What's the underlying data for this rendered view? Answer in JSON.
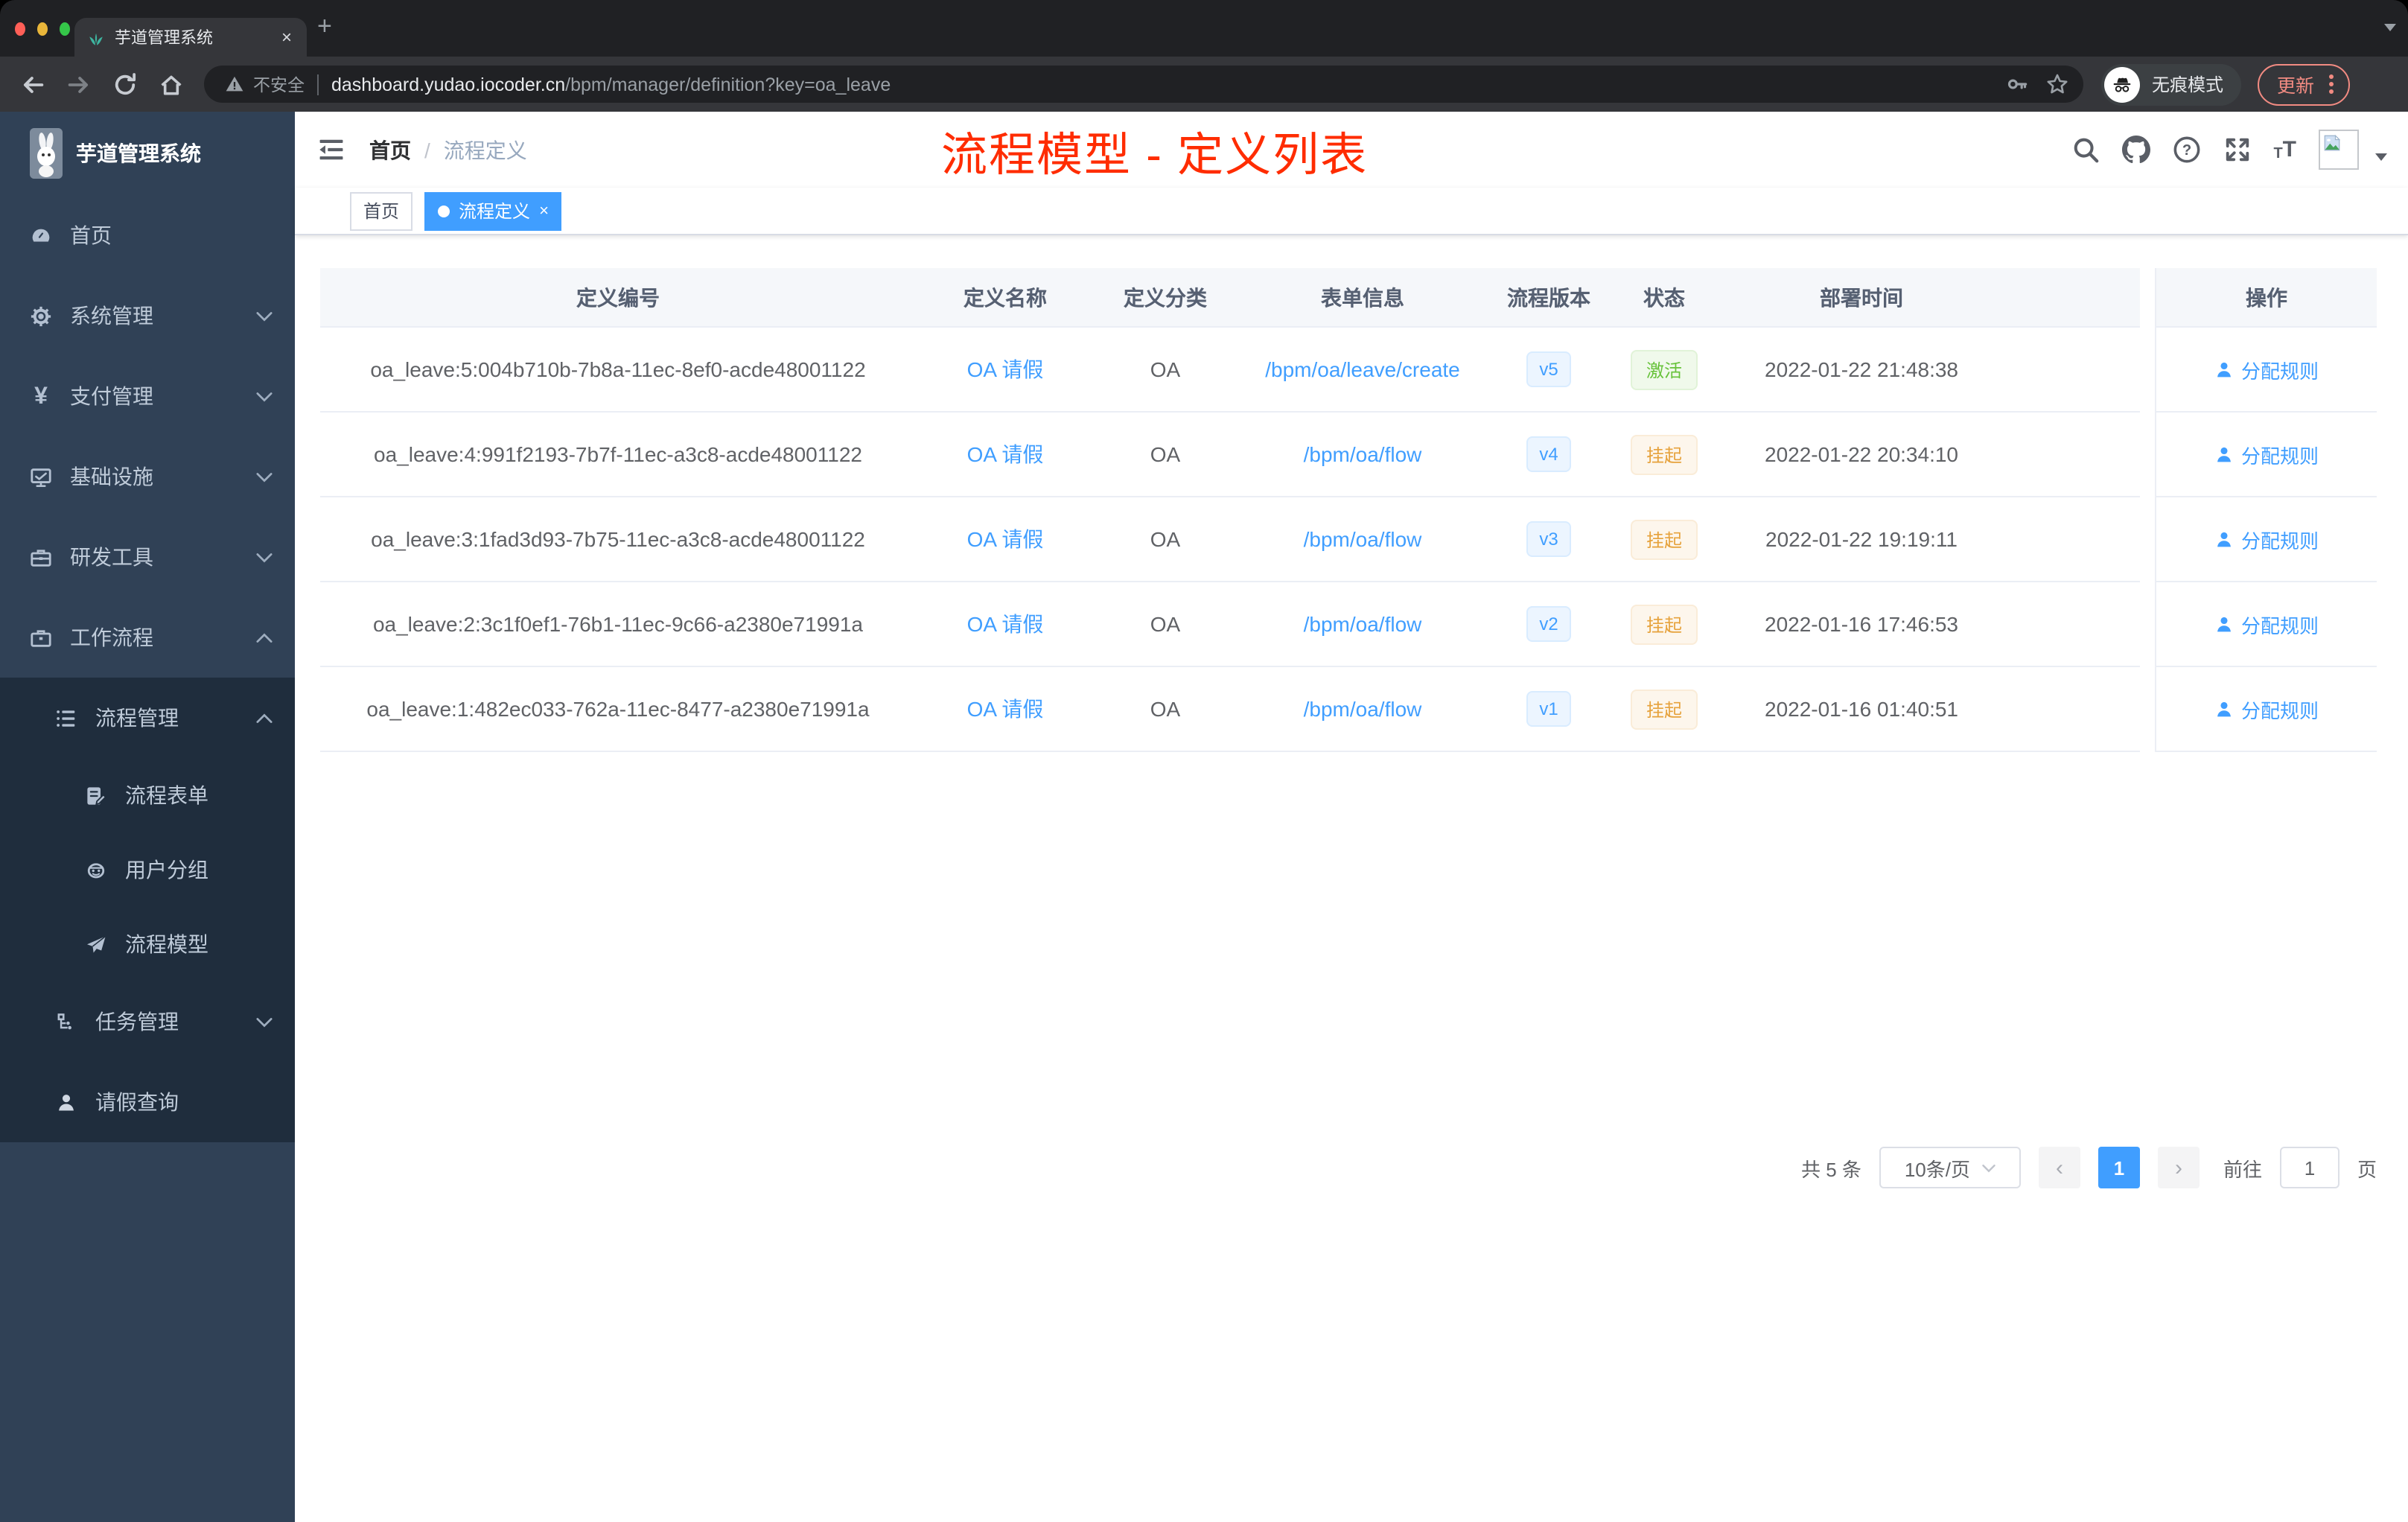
{
  "browser": {
    "tab": {
      "title": "芋道管理系统",
      "close_glyph": "×",
      "new_tab_glyph": "+"
    },
    "toolbar": {
      "security_label": "不安全",
      "url_host": "dashboard.yudao.iocoder.cn",
      "url_path": "/bpm/manager/definition?key=oa_leave",
      "incognito_label": "无痕模式",
      "update_label": "更新"
    }
  },
  "sidebar": {
    "logo_title": "芋道管理系统",
    "items": [
      {
        "label": "首页",
        "icon": "dashboard-icon"
      },
      {
        "label": "系统管理",
        "icon": "gear-icon",
        "arrow": "down"
      },
      {
        "label": "支付管理",
        "icon": "yen-icon",
        "arrow": "down",
        "icon_glyph": "¥"
      },
      {
        "label": "基础设施",
        "icon": "monitor-icon",
        "arrow": "down"
      },
      {
        "label": "研发工具",
        "icon": "toolbox-icon",
        "arrow": "down"
      },
      {
        "label": "工作流程",
        "icon": "briefcase-icon",
        "arrow": "up"
      },
      {
        "label": "流程管理",
        "icon": "list-tree-icon",
        "arrow": "up"
      },
      {
        "label": "流程表单",
        "icon": "form-edit-icon"
      },
      {
        "label": "用户分组",
        "icon": "robot-icon"
      },
      {
        "label": "流程模型",
        "icon": "paper-plane-icon"
      },
      {
        "label": "任务管理",
        "icon": "org-tree-icon",
        "arrow": "down"
      },
      {
        "label": "请假查询",
        "icon": "user-icon"
      }
    ]
  },
  "header": {
    "breadcrumb_home": "首页",
    "breadcrumb_sep": "/",
    "breadcrumb_current": "流程定义",
    "annotation": "流程模型 - 定义列表",
    "help_glyph": "?",
    "font_icon_small": "T",
    "font_icon_big": "T"
  },
  "tags": {
    "home": "首页",
    "active": "流程定义",
    "close_glyph": "×"
  },
  "table": {
    "columns": {
      "id": "定义编号",
      "name": "定义名称",
      "category": "定义分类",
      "form": "表单信息",
      "version": "流程版本",
      "status": "状态",
      "deploy_time": "部署时间",
      "action": "操作"
    },
    "rows": [
      {
        "id": "oa_leave:5:004b710b-7b8a-11ec-8ef0-acde48001122",
        "name": "OA 请假",
        "category": "OA",
        "form": "/bpm/oa/leave/create",
        "version": "v5",
        "status": "激活",
        "time": "2022-01-22 21:48:38",
        "action": "分配规则"
      },
      {
        "id": "oa_leave:4:991f2193-7b7f-11ec-a3c8-acde48001122",
        "name": "OA 请假",
        "category": "OA",
        "form": "/bpm/oa/flow",
        "version": "v4",
        "status": "挂起",
        "time": "2022-01-22 20:34:10",
        "action": "分配规则"
      },
      {
        "id": "oa_leave:3:1fad3d93-7b75-11ec-a3c8-acde48001122",
        "name": "OA 请假",
        "category": "OA",
        "form": "/bpm/oa/flow",
        "version": "v3",
        "status": "挂起",
        "time": "2022-01-22 19:19:11",
        "action": "分配规则"
      },
      {
        "id": "oa_leave:2:3c1f0ef1-76b1-11ec-9c66-a2380e71991a",
        "name": "OA 请假",
        "category": "OA",
        "form": "/bpm/oa/flow",
        "version": "v2",
        "status": "挂起",
        "time": "2022-01-16 17:46:53",
        "action": "分配规则"
      },
      {
        "id": "oa_leave:1:482ec033-762a-11ec-8477-a2380e71991a",
        "name": "OA 请假",
        "category": "OA",
        "form": "/bpm/oa/flow",
        "version": "v1",
        "status": "挂起",
        "time": "2022-01-16 01:40:51",
        "action": "分配规则"
      }
    ]
  },
  "pagination": {
    "total": "共 5 条",
    "page_size": "10条/页",
    "prev_glyph": "‹",
    "page": "1",
    "next_glyph": "›",
    "goto_label": "前往",
    "goto_value": "1",
    "page_unit": "页"
  },
  "colors": {
    "primary": "#409eff",
    "success": "#67c23a",
    "warning": "#e6a23c",
    "annotation_red": "#ff2c00",
    "sidebar_bg": "#304156",
    "submenu_bg": "#1f2d3d",
    "update_accent": "#f28b82",
    "tab_bg": "#35363a",
    "chrome_bg": "#202124"
  }
}
